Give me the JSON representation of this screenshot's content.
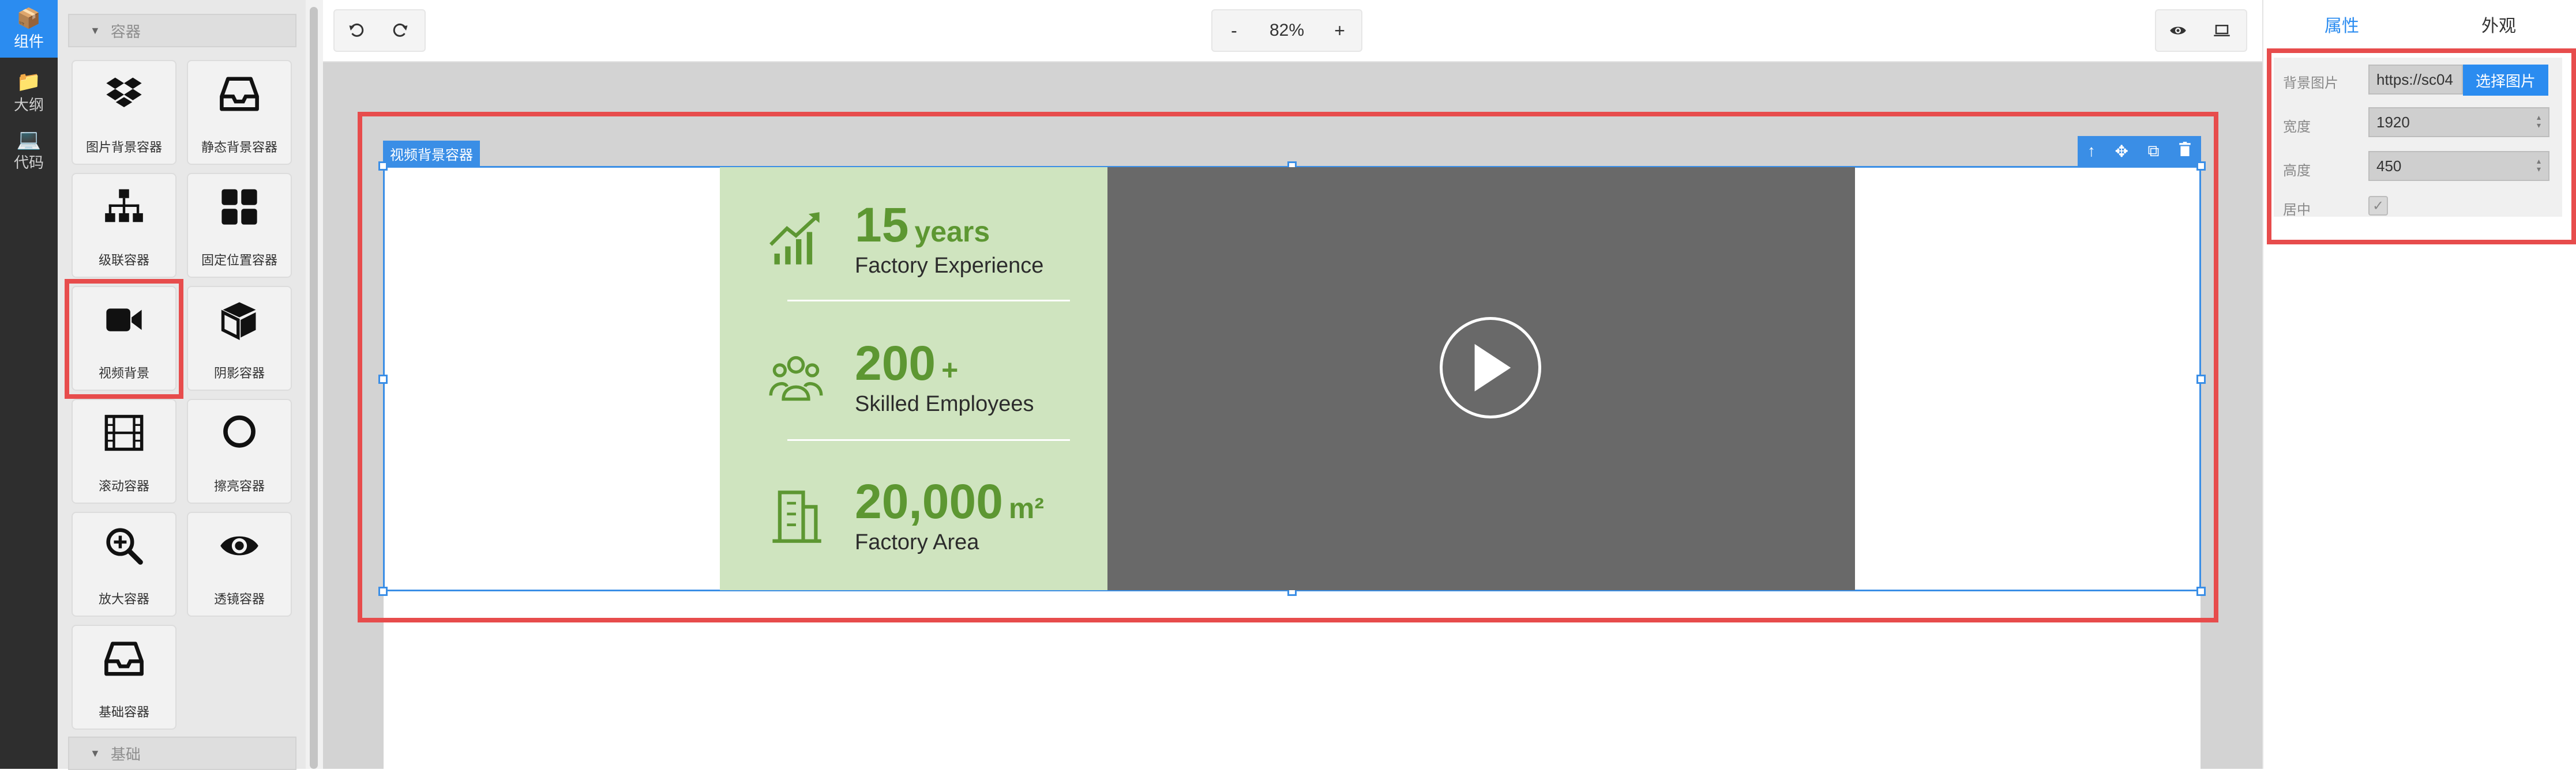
{
  "rail": {
    "items": [
      {
        "label": "组件",
        "icon": "package-icon"
      },
      {
        "label": "大纲",
        "icon": "folder-icon"
      },
      {
        "label": "代码",
        "icon": "laptop-icon"
      }
    ]
  },
  "palette": {
    "section_container": "容器",
    "section_basic": "基础",
    "tiles": [
      {
        "label": "图片背景容器",
        "icon": "dropbox-icon"
      },
      {
        "label": "静态背景容器",
        "icon": "inbox-icon"
      },
      {
        "label": "级联容器",
        "icon": "sitemap-icon"
      },
      {
        "label": "固定位置容器",
        "icon": "grid-icon"
      },
      {
        "label": "视频背景",
        "icon": "video-camera-icon"
      },
      {
        "label": "阴影容器",
        "icon": "cube-icon"
      },
      {
        "label": "滚动容器",
        "icon": "film-icon"
      },
      {
        "label": "擦亮容器",
        "icon": "circle-icon"
      },
      {
        "label": "放大容器",
        "icon": "zoom-in-icon"
      },
      {
        "label": "透镜容器",
        "icon": "eye-icon"
      },
      {
        "label": "基础容器",
        "icon": "inbox-icon"
      }
    ]
  },
  "toolbar": {
    "zoom_out": "-",
    "zoom_value": "82%",
    "zoom_in": "+"
  },
  "canvas": {
    "container_tag": "视频背景容器",
    "stats": [
      {
        "value": "15",
        "unit": "years",
        "label": "Factory Experience",
        "icon": "chart-growth-icon"
      },
      {
        "value": "200",
        "unit": "+",
        "label": "Skilled Employees",
        "icon": "people-icon"
      },
      {
        "value": "20,000",
        "unit": "m²",
        "label": "Factory Area",
        "icon": "building-icon"
      }
    ]
  },
  "props": {
    "tab_properties": "属性",
    "tab_appearance": "外观",
    "bg_image_label": "背景图片",
    "bg_image_value": "https://sc04",
    "choose_image": "选择图片",
    "width_label": "宽度",
    "width_value": "1920",
    "height_label": "高度",
    "height_value": "450",
    "center_label": "居中"
  }
}
